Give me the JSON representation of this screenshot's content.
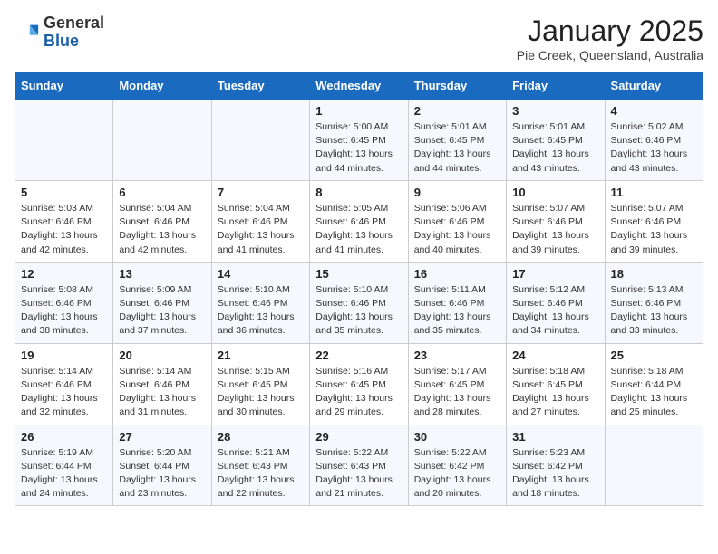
{
  "logo": {
    "general": "General",
    "blue": "Blue"
  },
  "header": {
    "title": "January 2025",
    "subtitle": "Pie Creek, Queensland, Australia"
  },
  "days_of_week": [
    "Sunday",
    "Monday",
    "Tuesday",
    "Wednesday",
    "Thursday",
    "Friday",
    "Saturday"
  ],
  "weeks": [
    [
      {
        "day": "",
        "info": ""
      },
      {
        "day": "",
        "info": ""
      },
      {
        "day": "",
        "info": ""
      },
      {
        "day": "1",
        "sunrise": "5:00 AM",
        "sunset": "6:45 PM",
        "daylight": "13 hours and 44 minutes."
      },
      {
        "day": "2",
        "sunrise": "5:01 AM",
        "sunset": "6:45 PM",
        "daylight": "13 hours and 44 minutes."
      },
      {
        "day": "3",
        "sunrise": "5:01 AM",
        "sunset": "6:45 PM",
        "daylight": "13 hours and 43 minutes."
      },
      {
        "day": "4",
        "sunrise": "5:02 AM",
        "sunset": "6:46 PM",
        "daylight": "13 hours and 43 minutes."
      }
    ],
    [
      {
        "day": "5",
        "sunrise": "5:03 AM",
        "sunset": "6:46 PM",
        "daylight": "13 hours and 42 minutes."
      },
      {
        "day": "6",
        "sunrise": "5:04 AM",
        "sunset": "6:46 PM",
        "daylight": "13 hours and 42 minutes."
      },
      {
        "day": "7",
        "sunrise": "5:04 AM",
        "sunset": "6:46 PM",
        "daylight": "13 hours and 41 minutes."
      },
      {
        "day": "8",
        "sunrise": "5:05 AM",
        "sunset": "6:46 PM",
        "daylight": "13 hours and 41 minutes."
      },
      {
        "day": "9",
        "sunrise": "5:06 AM",
        "sunset": "6:46 PM",
        "daylight": "13 hours and 40 minutes."
      },
      {
        "day": "10",
        "sunrise": "5:07 AM",
        "sunset": "6:46 PM",
        "daylight": "13 hours and 39 minutes."
      },
      {
        "day": "11",
        "sunrise": "5:07 AM",
        "sunset": "6:46 PM",
        "daylight": "13 hours and 39 minutes."
      }
    ],
    [
      {
        "day": "12",
        "sunrise": "5:08 AM",
        "sunset": "6:46 PM",
        "daylight": "13 hours and 38 minutes."
      },
      {
        "day": "13",
        "sunrise": "5:09 AM",
        "sunset": "6:46 PM",
        "daylight": "13 hours and 37 minutes."
      },
      {
        "day": "14",
        "sunrise": "5:10 AM",
        "sunset": "6:46 PM",
        "daylight": "13 hours and 36 minutes."
      },
      {
        "day": "15",
        "sunrise": "5:10 AM",
        "sunset": "6:46 PM",
        "daylight": "13 hours and 35 minutes."
      },
      {
        "day": "16",
        "sunrise": "5:11 AM",
        "sunset": "6:46 PM",
        "daylight": "13 hours and 35 minutes."
      },
      {
        "day": "17",
        "sunrise": "5:12 AM",
        "sunset": "6:46 PM",
        "daylight": "13 hours and 34 minutes."
      },
      {
        "day": "18",
        "sunrise": "5:13 AM",
        "sunset": "6:46 PM",
        "daylight": "13 hours and 33 minutes."
      }
    ],
    [
      {
        "day": "19",
        "sunrise": "5:14 AM",
        "sunset": "6:46 PM",
        "daylight": "13 hours and 32 minutes."
      },
      {
        "day": "20",
        "sunrise": "5:14 AM",
        "sunset": "6:46 PM",
        "daylight": "13 hours and 31 minutes."
      },
      {
        "day": "21",
        "sunrise": "5:15 AM",
        "sunset": "6:45 PM",
        "daylight": "13 hours and 30 minutes."
      },
      {
        "day": "22",
        "sunrise": "5:16 AM",
        "sunset": "6:45 PM",
        "daylight": "13 hours and 29 minutes."
      },
      {
        "day": "23",
        "sunrise": "5:17 AM",
        "sunset": "6:45 PM",
        "daylight": "13 hours and 28 minutes."
      },
      {
        "day": "24",
        "sunrise": "5:18 AM",
        "sunset": "6:45 PM",
        "daylight": "13 hours and 27 minutes."
      },
      {
        "day": "25",
        "sunrise": "5:18 AM",
        "sunset": "6:44 PM",
        "daylight": "13 hours and 25 minutes."
      }
    ],
    [
      {
        "day": "26",
        "sunrise": "5:19 AM",
        "sunset": "6:44 PM",
        "daylight": "13 hours and 24 minutes."
      },
      {
        "day": "27",
        "sunrise": "5:20 AM",
        "sunset": "6:44 PM",
        "daylight": "13 hours and 23 minutes."
      },
      {
        "day": "28",
        "sunrise": "5:21 AM",
        "sunset": "6:43 PM",
        "daylight": "13 hours and 22 minutes."
      },
      {
        "day": "29",
        "sunrise": "5:22 AM",
        "sunset": "6:43 PM",
        "daylight": "13 hours and 21 minutes."
      },
      {
        "day": "30",
        "sunrise": "5:22 AM",
        "sunset": "6:42 PM",
        "daylight": "13 hours and 20 minutes."
      },
      {
        "day": "31",
        "sunrise": "5:23 AM",
        "sunset": "6:42 PM",
        "daylight": "13 hours and 18 minutes."
      },
      {
        "day": "",
        "info": ""
      }
    ]
  ]
}
